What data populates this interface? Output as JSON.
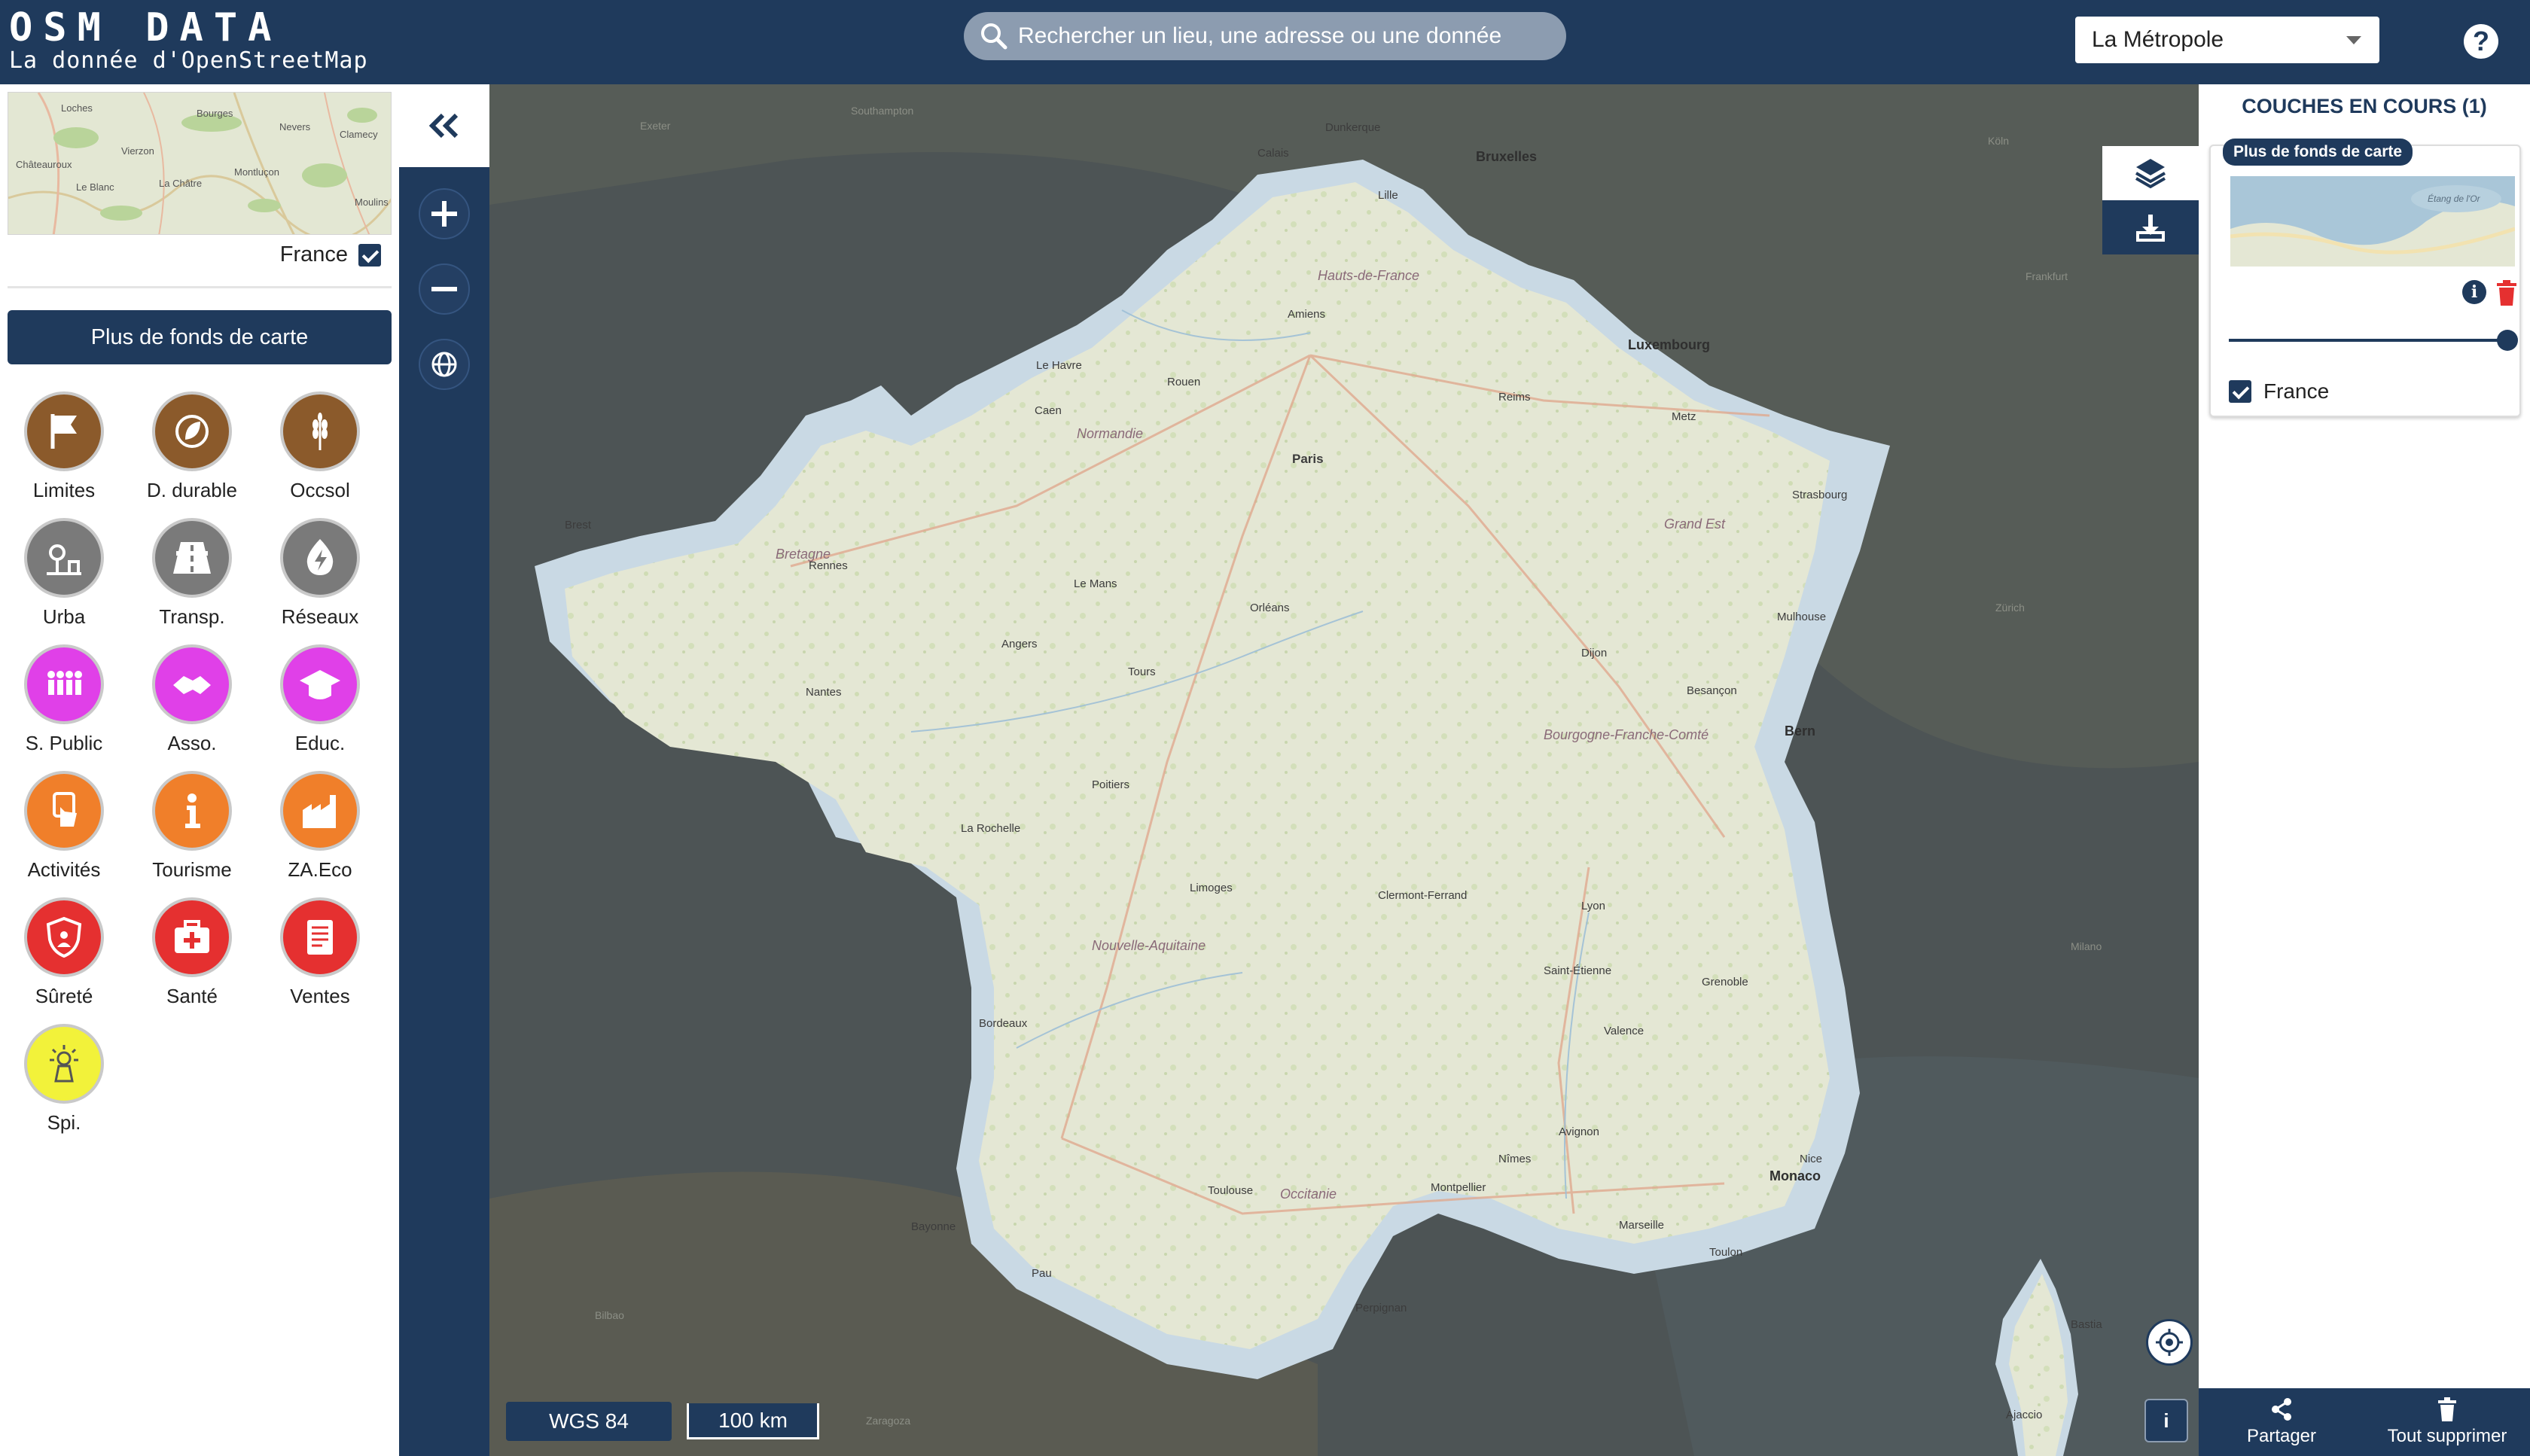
{
  "header": {
    "brand_title": "OSM DATA",
    "brand_subtitle": "La donnée d'OpenStreetMap",
    "search_placeholder": "Rechercher un lieu, une adresse ou une donnée",
    "region_selected": "La Métropole",
    "help_label": "?"
  },
  "sidebar": {
    "minimap_label": "France",
    "fonds_button": "Plus de fonds de carte",
    "themes": [
      {
        "label": "Limites",
        "color": "#8b5a2b",
        "icon": "flag-icon"
      },
      {
        "label": "D. durable",
        "color": "#8b5a2b",
        "icon": "leaf-icon"
      },
      {
        "label": "Occsol",
        "color": "#8b5a2b",
        "icon": "wheat-icon"
      },
      {
        "label": "Urba",
        "color": "#7a7a7a",
        "icon": "urban-icon"
      },
      {
        "label": "Transp.",
        "color": "#7a7a7a",
        "icon": "road-icon"
      },
      {
        "label": "Réseaux",
        "color": "#7a7a7a",
        "icon": "energy-icon"
      },
      {
        "label": "S. Public",
        "color": "#e040e8",
        "icon": "people-icon"
      },
      {
        "label": "Asso.",
        "color": "#e040e8",
        "icon": "handshake-icon"
      },
      {
        "label": "Educ.",
        "color": "#e040e8",
        "icon": "graduation-icon"
      },
      {
        "label": "Activités",
        "color": "#f07f2a",
        "icon": "hand-icon"
      },
      {
        "label": "Tourisme",
        "color": "#f07f2a",
        "icon": "info-icon"
      },
      {
        "label": "ZA.Eco",
        "color": "#f07f2a",
        "icon": "factory-icon"
      },
      {
        "label": "Sûreté",
        "color": "#e53030",
        "icon": "shield-icon"
      },
      {
        "label": "Santé",
        "color": "#e53030",
        "icon": "medkit-icon"
      },
      {
        "label": "Ventes",
        "color": "#e53030",
        "icon": "receipt-icon"
      },
      {
        "label": "Spi.",
        "color": "#f2f23a",
        "icon": "spiritual-icon"
      }
    ]
  },
  "map": {
    "projection": "WGS 84",
    "scale": "100 km",
    "info_label": "i",
    "labels": {
      "countries": [
        "Luxembourg",
        "Bruxelles",
        "Monaco",
        "Bern"
      ],
      "cities": [
        "Dunkerque",
        "Calais",
        "Lille",
        "Le Havre",
        "Rouen",
        "Amiens",
        "Caen",
        "Brest",
        "Rennes",
        "Nantes",
        "Paris",
        "Reims",
        "Metz",
        "Strasbourg",
        "Tours",
        "Orléans",
        "Dijon",
        "Besançon",
        "Mulhouse",
        "Poitiers",
        "La Rochelle",
        "Limoges",
        "Clermont-Ferrand",
        "Lyon",
        "Grenoble",
        "Bordeaux",
        "Toulouse",
        "Montpellier",
        "Nîmes",
        "Avignon",
        "Marseille",
        "Toulon",
        "Nice",
        "Perpignan",
        "Bayonne",
        "Pau",
        "Ajaccio",
        "Bastia",
        "Le Mans",
        "Angers",
        "Saint-Étienne",
        "Valence"
      ],
      "regions": [
        "Normandie",
        "Bretagne",
        "Hauts-de-France",
        "Grand Est",
        "Bourgogne-Franche-Comté",
        "Nouvelle-Aquitaine",
        "Occitanie"
      ]
    }
  },
  "right_panel": {
    "title": "COUCHES EN COURS (1)",
    "layer_badge": "Plus de fonds de carte",
    "thumb_label": "Étang de l'Or",
    "layer_name": "France",
    "opacity": 1.0,
    "share_label": "Partager",
    "delete_all_label": "Tout supprimer"
  },
  "colors": {
    "primary": "#1f3a5c",
    "map_dark": "#4f5556",
    "map_land": "#e4e7d4",
    "water": "#c9d9e4"
  }
}
